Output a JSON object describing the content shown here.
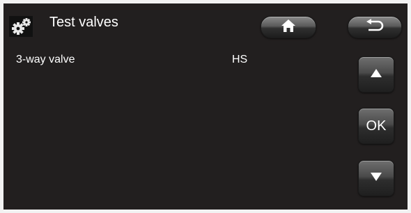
{
  "header": {
    "title": "Test valves",
    "icon": "gears-icon",
    "home_icon": "home-icon",
    "back_icon": "back-arrow-icon"
  },
  "rows": [
    {
      "label": "3-way valve",
      "value": "HS"
    }
  ],
  "nav": {
    "up_icon": "triangle-up-icon",
    "ok_label": "OK",
    "down_icon": "triangle-down-icon"
  },
  "colors": {
    "background": "#221f1f",
    "text": "#ffffff",
    "button": "#4a4a4a"
  }
}
